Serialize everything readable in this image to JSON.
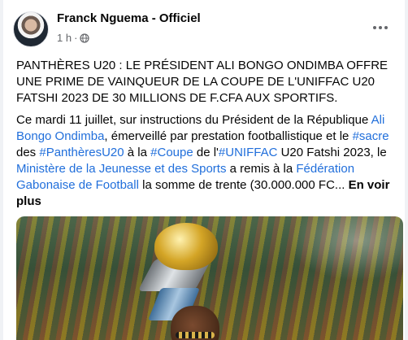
{
  "post": {
    "author": "Franck Nguema - Officiel",
    "time": "1 h",
    "separator": "·",
    "title": "PANTHÈRES U20 : LE PRÉSIDENT ALI BONGO ONDIMBA OFFRE UNE PRIME DE VAINQUEUR DE LA COUPE DE L'UNIFFAC U20 FATSHI 2023 DE 30 MILLIONS DE F.CFA AUX SPORTIFS.",
    "body": {
      "t1": "Ce mardi 11 juillet, sur instructions du Président de la République ",
      "link_president": "Ali Bongo Ondimba",
      "t2": ", émerveillé par prestation footballistique et le ",
      "tag_sacre": "#sacre",
      "t3": " des ",
      "tag_panthere": "#PanthèresU20",
      "t4": " à la ",
      "tag_coupe": "#Coupe",
      "t5": " de l'",
      "tag_uniffac": "#UNIFFAC",
      "t6": " U20 Fatshi 2023, le ",
      "link_ministere": "Ministère de la Jeunesse et des Sports",
      "t7": " a remis à la ",
      "link_federation": "Fédération Gabonaise de Football",
      "t8": " la somme de trente (30.000.000 FC... ",
      "see_more": "En voir plus"
    }
  },
  "icons": {
    "globe": "globe-icon",
    "more": "more-options-icon"
  },
  "colors": {
    "link": "#216fdb",
    "secondary_text": "#65676b",
    "background": "#f0f2f5"
  }
}
